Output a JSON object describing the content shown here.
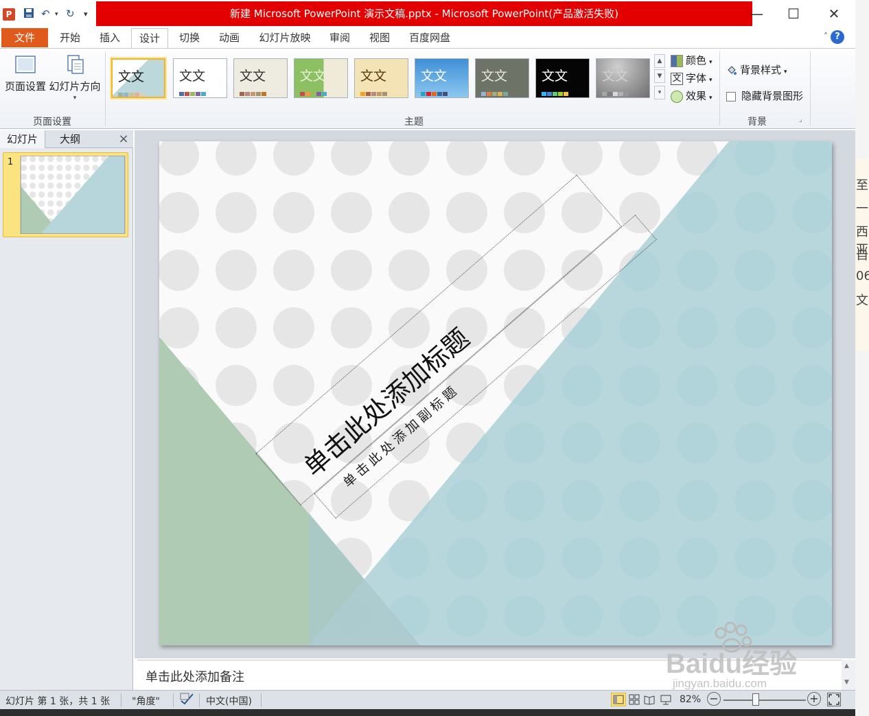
{
  "window": {
    "title": "新建 Microsoft PowerPoint 演示文稿.pptx - Microsoft PowerPoint(产品激活失败)",
    "app_icon": "P"
  },
  "tabs": [
    "文件",
    "开始",
    "插入",
    "设计",
    "切换",
    "动画",
    "幻灯片放映",
    "审阅",
    "视图",
    "百度网盘"
  ],
  "active_tab": "设计",
  "ribbon": {
    "page_setup": {
      "page_setup_label": "页面设置",
      "orientation_label": "幻灯片方向",
      "group_label": "页面设置"
    },
    "themes": {
      "group_label": "主题",
      "sample_text": "文文",
      "items": [
        {
          "bg": "#dbe9e5",
          "fg": "#222",
          "bars": [
            "#9bb3a4",
            "#8fb6c8",
            "#c9c39a",
            "#e0b0a0",
            "#d8d0c0"
          ]
        },
        {
          "bg": "#ffffff",
          "fg": "#333",
          "bars": [
            "#4f6fa8",
            "#c0504d",
            "#9bbb59",
            "#8064a2",
            "#4bacc6"
          ]
        },
        {
          "bg": "#eeece0",
          "fg": "#333",
          "bars": [
            "#a5644e",
            "#b58b80",
            "#c3986d",
            "#a19574",
            "#c17529"
          ]
        },
        {
          "bg": "#8cc063",
          "fg": "#e8f3d8",
          "bars": [
            "#c0504d",
            "#f79646",
            "#9bbb59",
            "#8064a2",
            "#4bacc6"
          ]
        },
        {
          "bg": "#f3e3b5",
          "fg": "#5a3b10",
          "bars": [
            "#f0a22e",
            "#a5644e",
            "#b58b80",
            "#c3986d",
            "#a19574"
          ]
        },
        {
          "bg": "#3f8fd6",
          "fg": "#ffffff",
          "bars": [
            "#2da2bf",
            "#da1f28",
            "#eb641b",
            "#39639d",
            "#474b78"
          ]
        },
        {
          "bg": "#6e7367",
          "fg": "#e6e6d8",
          "bars": [
            "#94b6d2",
            "#dd8047",
            "#a5ab81",
            "#d8b25c",
            "#7ba79d"
          ]
        },
        {
          "bg": "#050505",
          "fg": "#ffffff",
          "bars": [
            "#31b6fd",
            "#4584d3",
            "#5bd078",
            "#a5d028",
            "#f5c040"
          ]
        },
        {
          "bg": "#8a8a8a",
          "fg": "#d0d0d0",
          "bars": [
            "#a5a5a5",
            "#7f7f7f",
            "#d8d8d8",
            "#b2b2b2",
            "#969696"
          ]
        }
      ]
    },
    "theme_options": {
      "colors_label": "颜色",
      "fonts_label": "字体",
      "effects_label": "效果"
    },
    "background": {
      "styles_label": "背景样式",
      "hide_graphics_label": "隐藏背景图形",
      "group_label": "背景"
    }
  },
  "left_panel": {
    "slides_tab": "幻灯片",
    "outline_tab": "大纲",
    "close_icon": "×",
    "slide_number": "1"
  },
  "slide": {
    "title_placeholder": "单击此处添加标题",
    "subtitle_placeholder": "单击此处添加副标题"
  },
  "notes": {
    "placeholder": "单击此处添加备注"
  },
  "status": {
    "slide_info": "幻灯片 第 1 张，共 1 张",
    "theme_name": "\"角度\"",
    "language": "中文(中国)",
    "zoom": "82%"
  },
  "right_slice": [
    "至",
    "一",
    "西亚",
    "自",
    "06",
    "文"
  ],
  "watermark": {
    "brand": "Baidu经验",
    "url": "jingyan.baidu.com"
  },
  "colors": {
    "title_bar_red": "#e30000",
    "file_tab": "#e05a1c",
    "slide_blue": "#b6d6dc",
    "slide_green": "#afcbb4"
  }
}
